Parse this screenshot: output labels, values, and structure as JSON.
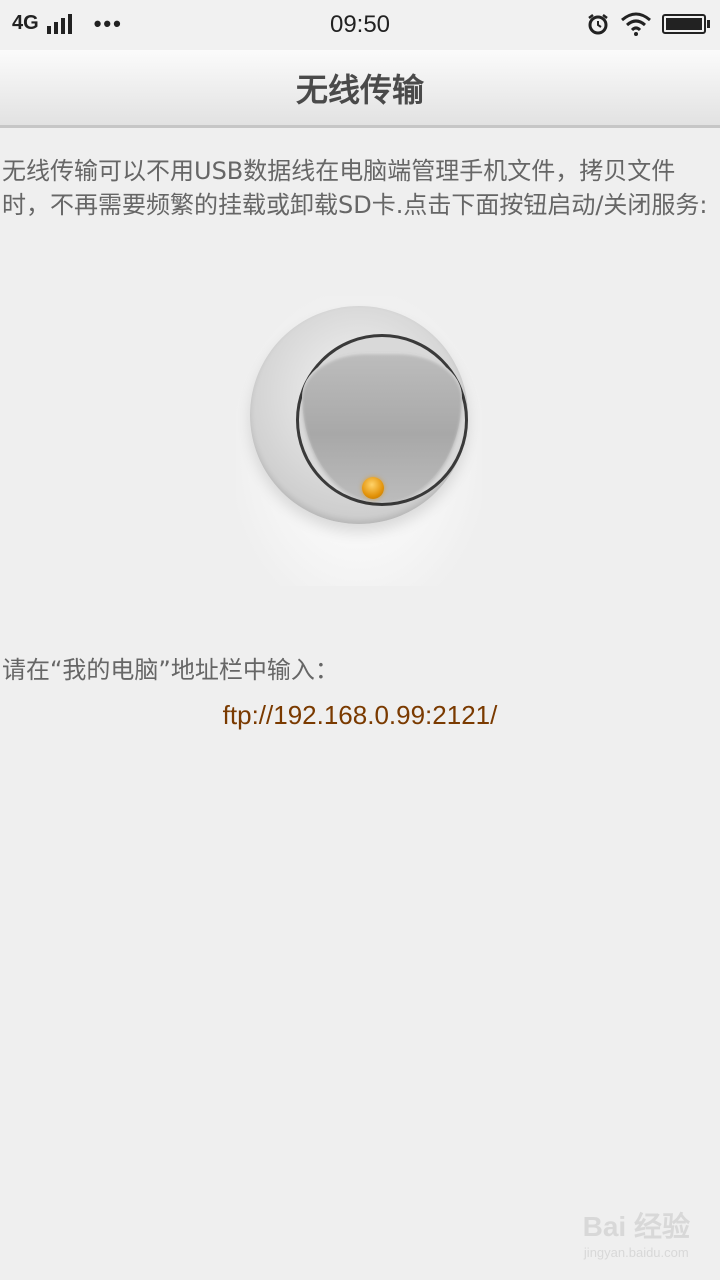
{
  "status_bar": {
    "network": "4G",
    "more": "•••",
    "time": "09:50"
  },
  "header": {
    "title": "无线传输"
  },
  "main": {
    "description": "无线传输可以不用USB数据线在电脑端管理手机文件，拷贝文件时，不再需要频繁的挂载或卸载SD卡.点击下面按钮启动/关闭服务:",
    "prompt": "请在“我的电脑”地址栏中输入：",
    "ftp_address": "ftp://192.168.0.99:2121/"
  },
  "watermark": {
    "main": "Bai 经验",
    "sub": "jingyan.baidu.com"
  },
  "colors": {
    "background": "#efefef",
    "address": "#7a3a00",
    "led": "#e3930a"
  },
  "icons": [
    "signal-icon",
    "alarm-icon",
    "wifi-icon",
    "battery-icon",
    "power-switch-icon"
  ]
}
